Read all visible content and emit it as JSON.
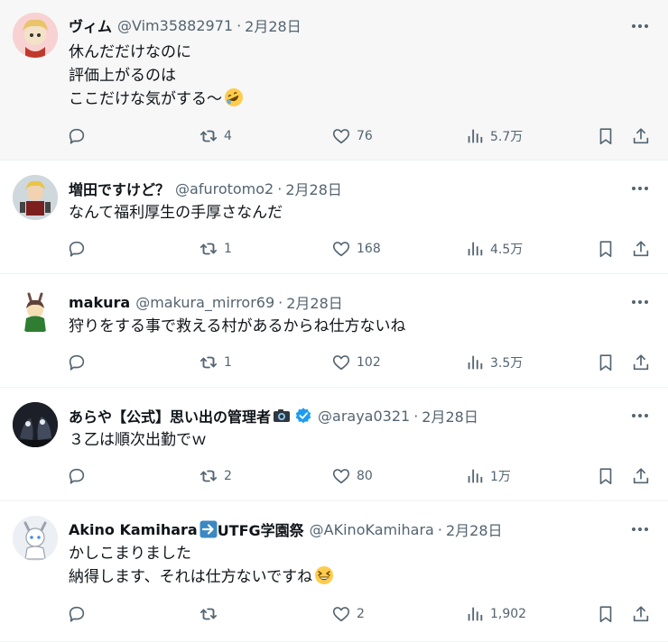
{
  "tweets": [
    {
      "name": "ヴィム",
      "handle": "@Vim35882971",
      "date": "2月28日",
      "body": "休んだだけなのに\n評価上がるのは\nここだけな気がする～",
      "body_emoji": "rolling-on-floor-laughing-emoji",
      "replies": "",
      "retweets": "4",
      "likes": "76",
      "views": "5.7万",
      "hovered": true,
      "avatar_color": "#f6c7c9"
    },
    {
      "name": "増田ですけど？",
      "handle": "@afurotomo2",
      "date": "2月28日",
      "body": "なんて福利厚生の手厚さなんだ",
      "replies": "",
      "retweets": "1",
      "likes": "168",
      "views": "4.5万",
      "avatar_color": "#d9d4c8"
    },
    {
      "name": "makura",
      "handle": "@makura_mirror69",
      "date": "2月28日",
      "body": "狩りをする事で救える村があるからね仕方ないね",
      "replies": "",
      "retweets": "1",
      "likes": "102",
      "views": "3.5万",
      "avatar_color": "#ffffff"
    },
    {
      "name": "あらや【公式】思い出の管理者",
      "name_emoji": "camera-emoji",
      "verified": true,
      "handle": "@araya0321",
      "date": "2月28日",
      "body": "３乙は順次出勤でｗ",
      "replies": "",
      "retweets": "2",
      "likes": "80",
      "views": "1万",
      "avatar_color": "#1d1f26"
    },
    {
      "name": "Akino Kamihara",
      "name_emoji": "right-arrow-emoji",
      "name_suffix": "UTFG学園祭",
      "handle": "@AKinoKamihara",
      "date": "2月28日",
      "body": "かしこまりました\n納得します、それは仕方ないですね",
      "body_emoji": "grinning-squinting-emoji",
      "replies": "",
      "retweets": "",
      "likes": "2",
      "views": "1,902",
      "avatar_color": "#eef0f4"
    }
  ],
  "colors": {
    "text": "#0f1419",
    "secondary": "#536471",
    "divider": "#eff3f4",
    "hover_bg": "#f7f7f7",
    "verified": "#1d9bf0"
  }
}
